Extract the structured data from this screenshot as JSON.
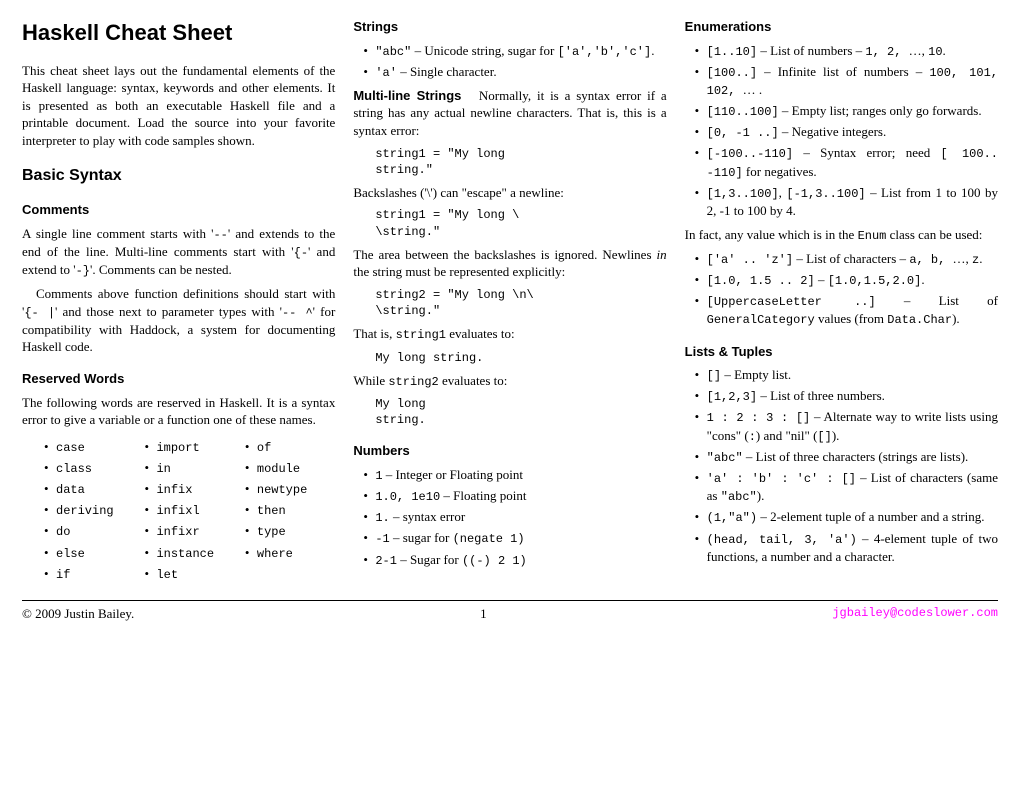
{
  "title": "Haskell Cheat Sheet",
  "intro": "This cheat sheet lays out the fundamental elements of the Haskell language: syntax, keywords and other elements. It is presented as both an executable Haskell file and a printable document. Load the source into your favorite interpreter to play with code samples shown.",
  "basic_syntax": {
    "heading": "Basic Syntax",
    "comments_h": "Comments",
    "comments_p1_a": "A single line comment starts with '",
    "comments_p1_b": "' and extends to the end of the line. Multi-line comments start with '",
    "comments_p1_c": "' and extend to '",
    "comments_p1_d": "'. Comments can be nested.",
    "dashdash": "--",
    "braceopen": "{-",
    "braceclose": "-}",
    "comments_p2_a": "Comments above function definitions should start with '",
    "comments_p2_b": "' and those next to parameter types with '",
    "comments_p2_c": "' for compatibility with Haddock, a system for documenting Haskell code.",
    "had_a": "{- |",
    "had_b": "-- ^",
    "reserved_h": "Reserved Words",
    "reserved_p": "The following words are reserved in Haskell. It is a syntax error to give a variable or a function one of these names.",
    "reserved_c1": [
      "case",
      "class",
      "data",
      "deriving",
      "do",
      "else",
      "if"
    ],
    "reserved_c2": [
      "import",
      "in",
      "infix",
      "infixl",
      "infixr",
      "instance",
      "let"
    ],
    "reserved_c3": [
      "of",
      "module",
      "newtype",
      "then",
      "type",
      "where"
    ]
  },
  "strings": {
    "heading": "Strings",
    "b1_a": "\"abc\"",
    "b1_b": " – Unicode string, sugar for ",
    "b1_c": "['a','b','c']",
    "b1_d": ".",
    "b2_a": "'a'",
    "b2_b": " – Single character.",
    "ml_head": "Multi-line Strings",
    "ml_p": "Normally, it is a syntax error if a string has any actual newline characters. That is, this is a syntax error:",
    "ml_code1": "string1 = \"My long\nstring.\"",
    "ml_p2": "Backslashes ('\\') can \"escape\" a newline:",
    "ml_code2": "string1 = \"My long \\\n\\string.\"",
    "ml_p3_a": "The area between the backslashes is ignored. Newlines ",
    "ml_p3_i": "in",
    "ml_p3_b": " the string must be represented explicitly:",
    "ml_code3": "string2 = \"My long \\n\\\n\\string.\"",
    "ml_p4_a": "That is, ",
    "ml_p4_b": " evaluates to:",
    "s1": "string1",
    "ml_code4": "My long string.",
    "ml_p5_a": "While ",
    "ml_p5_b": " evaluates to:",
    "s2": "string2",
    "ml_code5": "My long\nstring.",
    "numbers_h": "Numbers",
    "n1_a": "1",
    "n1_b": " – Integer or Floating point",
    "n2_a": "1.0, 1e10",
    "n2_b": " – Floating point",
    "n3_a": "1.",
    "n3_b": " – syntax error",
    "n4_a": "-1",
    "n4_b": " – sugar for ",
    "n4_c": "(negate 1)",
    "n5_a": "2-1",
    "n5_b": " – Sugar for ",
    "n5_c": "((-) 2 1)"
  },
  "enums": {
    "heading": "Enumerations",
    "e1_a": "[1..10]",
    "e1_b": " – List of numbers – ",
    "e1_c": "1, 2, ",
    "e1_d": "…, ",
    "e1_e": "10",
    "e1_f": ".",
    "e2_a": "[100..]",
    "e2_b": " – Infinite list of numbers – ",
    "e2_c": "100, 101, 102, ",
    "e2_d": "… .",
    "e3_a": "[110..100]",
    "e3_b": " – Empty list; ranges only go forwards.",
    "e4_a": "[0, -1 ..]",
    "e4_b": " – Negative integers.",
    "e5_a": "[-100..-110]",
    "e5_b": " – Syntax error; need ",
    "e5_c": "[ 100.. -110]",
    "e5_d": " for negatives.",
    "e6_a": "[1,3..100]",
    "e6_b": ", ",
    "e6_c": "[-1,3..100]",
    "e6_d": " – List from 1 to 100 by 2, -1 to 100 by 4.",
    "enum_p_a": "In fact, any value which is in the ",
    "enum_class": "Enum",
    "enum_p_b": " class can be used:",
    "u1_a": "['a' .. 'z']",
    "u1_b": " – List of characters – ",
    "u1_c": "a, b, ",
    "u1_d": "…, ",
    "u1_e": "z",
    "u1_f": ".",
    "u2_a": "[1.0, 1.5 .. 2]",
    "u2_b": " – ",
    "u2_c": "[1.0,1.5,2.0]",
    "u2_d": ".",
    "u3_a": "[UppercaseLetter ..]",
    "u3_b": " – List of ",
    "u3_c": "GeneralCategory",
    "u3_d": " values (from ",
    "u3_e": "Data.Char",
    "u3_f": ").",
    "lists_h": "Lists & Tuples",
    "l1_a": "[]",
    "l1_b": " – Empty list.",
    "l2_a": "[1,2,3]",
    "l2_b": " – List of three numbers.",
    "l3_a": "1 : 2 : 3 : []",
    "l3_b": " – Alternate way to write lists using \"cons\" (",
    "l3_c": ":",
    "l3_d": ") and \"nil\" (",
    "l3_e": "[]",
    "l3_f": ").",
    "l4_a": "\"abc\"",
    "l4_b": " – List of three characters (strings are lists).",
    "l5_a": "'a' : 'b' : 'c' : []",
    "l5_b": " – List of characters (same as ",
    "l5_c": "\"abc\"",
    "l5_d": ").",
    "l6_a": "(1,\"a\")",
    "l6_b": " – 2-element tuple of a number and a string.",
    "l7_a": "(head, tail, 3, 'a')",
    "l7_b": " – 4-element tuple of two functions, a number and a character."
  },
  "footer": {
    "copyright": "© 2009 Justin Bailey.",
    "page": "1",
    "email": "jgbailey@codeslower.com"
  }
}
